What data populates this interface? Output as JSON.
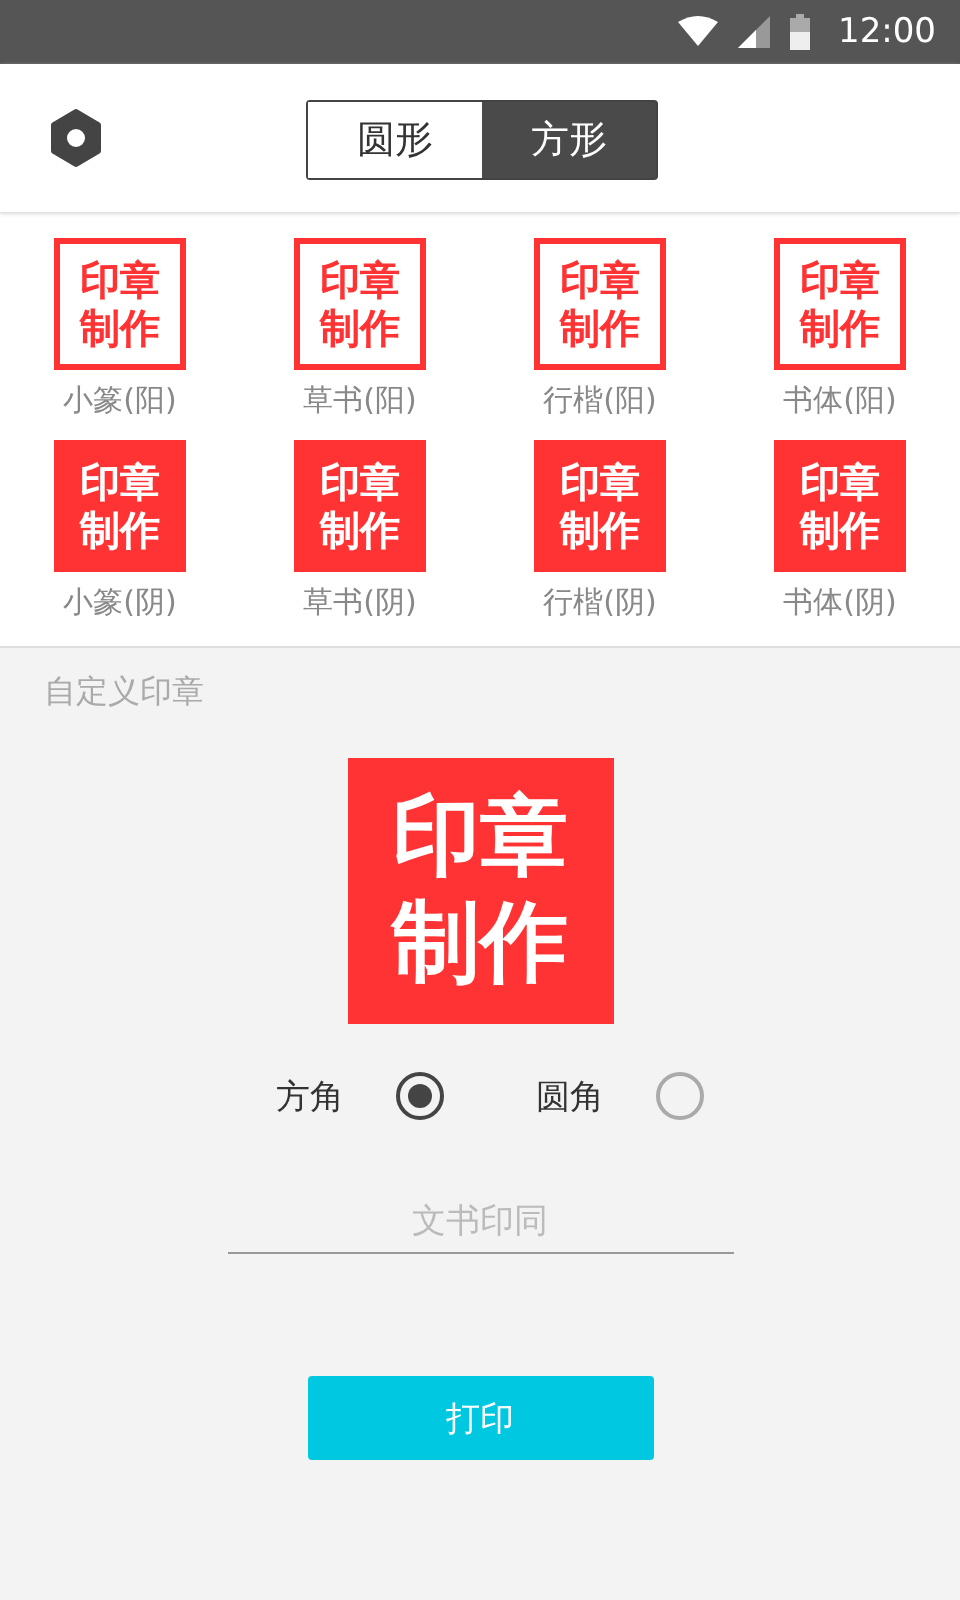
{
  "status_bar": {
    "time": "12:00"
  },
  "header": {
    "shape_tabs": [
      {
        "label": "圆形",
        "selected": false
      },
      {
        "label": "方形",
        "selected": true
      }
    ]
  },
  "presets": [
    {
      "text": "印章制作",
      "kind": "outline",
      "label": "小篆(阳)"
    },
    {
      "text": "印章制作",
      "kind": "outline",
      "label": "草书(阳)"
    },
    {
      "text": "印章制作",
      "kind": "outline",
      "label": "行楷(阳)"
    },
    {
      "text": "印章制作",
      "kind": "outline",
      "label": "书体(阳)"
    },
    {
      "text": "印章制作",
      "kind": "filled",
      "label": "小篆(阴)"
    },
    {
      "text": "印章制作",
      "kind": "filled",
      "label": "草书(阴)"
    },
    {
      "text": "印章制作",
      "kind": "filled",
      "label": "行楷(阴)"
    },
    {
      "text": "印章制作",
      "kind": "filled",
      "label": "书体(阴)"
    }
  ],
  "custom": {
    "title": "自定义印章",
    "preview": {
      "text": "印章制作",
      "kind": "filled"
    },
    "corners": [
      {
        "label": "方角",
        "selected": true
      },
      {
        "label": "圆角",
        "selected": false
      }
    ],
    "text_field": {
      "placeholder": "文书印同"
    },
    "print_button": "打印"
  }
}
